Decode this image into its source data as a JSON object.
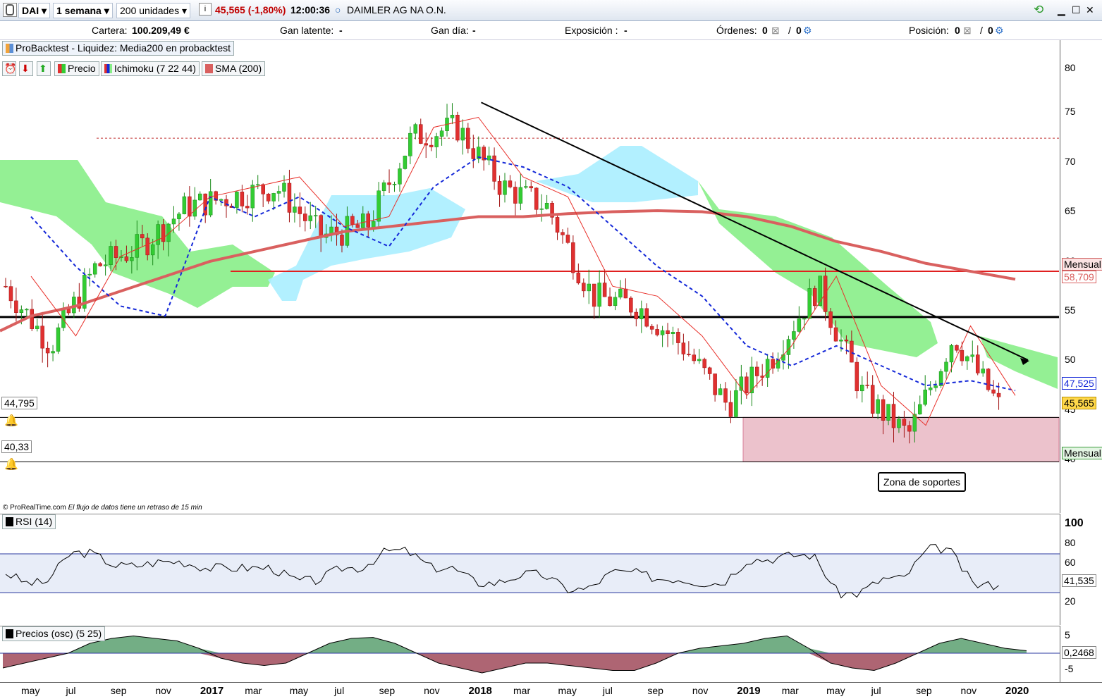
{
  "toolbar": {
    "symbol": "DAI",
    "period": "1 semana",
    "units": "200 unidades",
    "price": "45,565 (-1,80%)",
    "time": "12:00:36",
    "name": "DAIMLER AG NA O.N."
  },
  "stats": {
    "cartera_label": "Cartera:",
    "cartera_value": "100.209,49 €",
    "gan_latente_label": "Gan latente:",
    "gan_latente_value": "-",
    "gan_dia_label": "Gan día:",
    "gan_dia_value": "-",
    "exposicion_label": "Exposición :",
    "exposicion_value": "-",
    "ordenes_label": "Órdenes:",
    "ordenes_a": "0",
    "ordenes_b": "0",
    "posicion_label": "Posición:",
    "posicion_a": "0",
    "posicion_b": "0"
  },
  "backtest_label": "ProBacktest - Liquidez: Media200 en probacktest",
  "legend": {
    "precio": "Precio",
    "ichimoku": "Ichimoku (7 22 44)",
    "sma": "SMA (200)"
  },
  "alerts": {
    "a1": "44,795",
    "a2": "40,33"
  },
  "annotation": "Zona de soportes",
  "footer_credit": "© ProRealTime.com",
  "footer_delay": "El flujo de datos tiene un retraso de 15 min",
  "price_axis": {
    "ticks": [
      "80",
      "75",
      "70",
      "65",
      "60",
      "55",
      "50",
      "45",
      "40"
    ],
    "tag_mensual": "Mensual",
    "tag_sma": "58,709",
    "tag_kijun": "47,525",
    "tag_price": "45,565",
    "tag_mensual2": "Mensual"
  },
  "rsi": {
    "label": "RSI (14)",
    "ticks": [
      "100",
      "80",
      "60",
      "20"
    ],
    "value": "41,535"
  },
  "osc": {
    "label": "Precios (osc) (5 25)",
    "ticks": [
      "5",
      "-5"
    ],
    "value": "0,2468"
  },
  "x_labels": [
    "may",
    "jul",
    "sep",
    "nov",
    "2017",
    "mar",
    "may",
    "jul",
    "sep",
    "nov",
    "2018",
    "mar",
    "may",
    "jul",
    "sep",
    "nov",
    "2019",
    "mar",
    "may",
    "jul",
    "sep",
    "nov",
    "2020"
  ],
  "colors": {
    "up": "#33cc33",
    "down": "#e03030",
    "sma": "#d9605f",
    "kijun": "#1428d8",
    "tenkan": "#e8302a",
    "cloud_green": "#88ee88",
    "cloud_blue": "#aaeeff",
    "support_zone": "#e8b4c0"
  },
  "chart_data": {
    "type": "line",
    "title": "",
    "xlabel": "",
    "ylabel": "",
    "ylim": [
      37.5,
      80
    ],
    "x": [
      "2016-05",
      "2016-07",
      "2016-09",
      "2016-11",
      "2017-01",
      "2017-03",
      "2017-05",
      "2017-07",
      "2017-09",
      "2017-11",
      "2018-01",
      "2018-03",
      "2018-05",
      "2018-07",
      "2018-09",
      "2018-11",
      "2019-01",
      "2019-03",
      "2019-05",
      "2019-07",
      "2019-09",
      "2019-11",
      "2020-01"
    ],
    "series": [
      {
        "name": "Precio",
        "values": [
          58,
          52,
          60,
          62,
          66,
          67,
          68,
          63,
          64,
          73,
          74,
          68,
          66,
          57,
          56,
          52,
          46,
          51,
          58,
          47,
          43,
          53,
          46
        ]
      },
      {
        "name": "SMA (200)",
        "values": [
          55,
          56,
          57.5,
          59,
          60.5,
          61.5,
          62.5,
          63.5,
          64,
          64.5,
          65,
          65,
          65.3,
          65.5,
          65.6,
          65.5,
          65,
          64,
          62.5,
          61.5,
          60.3,
          59.5,
          58.7
        ]
      },
      {
        "name": "Kijun",
        "values": [
          65,
          60,
          56,
          55,
          67,
          65,
          67,
          64,
          62,
          68,
          71,
          70,
          68,
          64,
          60,
          57,
          52,
          50,
          52,
          50,
          48,
          48.5,
          47.5
        ]
      }
    ],
    "horizontal_lines": [
      59.5,
      54.9,
      72.9,
      44.8,
      40.33
    ],
    "trendline": {
      "from": [
        "2018-01",
        76.5
      ],
      "to": [
        "2020-01",
        50.5
      ]
    },
    "support_zone": [
      40.33,
      44.8
    ]
  }
}
